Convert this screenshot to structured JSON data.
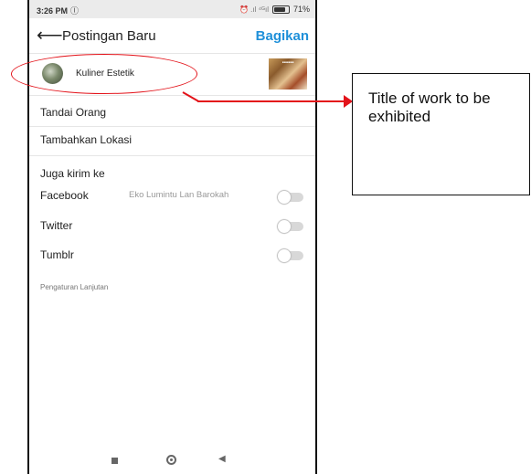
{
  "status_bar": {
    "time": "3:26 PM",
    "info_icon": "info-icon",
    "signal_text": "⏰ .ıl ⁴ᴳıl",
    "battery": "71%",
    "battery_level": 0.71
  },
  "header": {
    "title": "Postingan Baru",
    "share_label": "Bagikan",
    "back_icon": "arrow-left-icon"
  },
  "post": {
    "caption": "Kuliner Estetik",
    "thumbnail_label": "▪▪▪▪▪▪"
  },
  "options": {
    "tag_people": "Tandai Orang",
    "add_location": "Tambahkan Lokasi",
    "also_send_to": "Juga kirim ke",
    "share_targets": [
      {
        "label": "Facebook",
        "account": "Eko Lumintu Lan Barokah",
        "enabled": false
      },
      {
        "label": "Twitter",
        "account": "",
        "enabled": false
      },
      {
        "label": "Tumblr",
        "account": "",
        "enabled": false
      }
    ],
    "advanced_settings": "Pengaturan Lanjutan"
  },
  "nav_bar": {
    "icons": [
      "recents-square-icon",
      "home-circle-icon",
      "back-triangle-icon"
    ]
  },
  "annotation": {
    "text": "Title of work to be exhibited",
    "color": "#e3131a"
  },
  "colors": {
    "accent": "#1f90d9",
    "annotation": "#e3131a"
  }
}
